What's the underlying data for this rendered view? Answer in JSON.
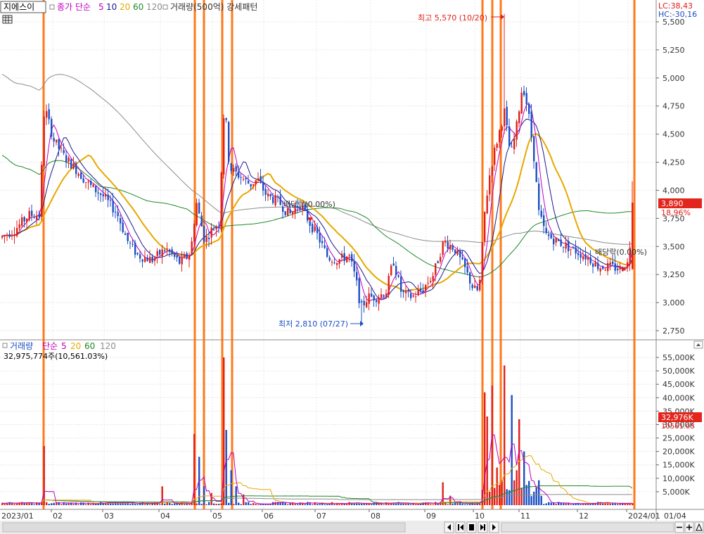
{
  "colors": {
    "up": "#e0201b",
    "down": "#1c4fc4",
    "ma5": "#c000c0",
    "ma10": "#1a1a8c",
    "ma20": "#e8a800",
    "ma60": "#1e8a28",
    "ma120": "#8c8c8c",
    "pattern": "#ff6a00",
    "axis_text": "#333333",
    "badge_red": "#e3261d"
  },
  "top_legend": {
    "stock_name": "지에스이",
    "close_label": "종가 단순",
    "ma_periods": [
      "5",
      "10",
      "20",
      "60",
      "120"
    ],
    "volume_label": "거래량(500억) 강세패턴"
  },
  "top_right": {
    "lc": "LC:38,43",
    "hc": "HC:-30,16"
  },
  "price_axis": {
    "ticks": [
      "5,500",
      "5,250",
      "5,000",
      "4,750",
      "4,500",
      "4,250",
      "4,000",
      "3,750",
      "3,500",
      "3,250",
      "3,000",
      "2,750"
    ],
    "current_price": "3,890",
    "current_change": "18.96%"
  },
  "annotations": {
    "high": "최고 5,570 (10/20)",
    "low": "최저 2,810 (07/27)",
    "dividend1": "배당락(0.00%)",
    "dividend2": "배당락(0.00%)"
  },
  "volume_legend": {
    "label": "거래량",
    "ma_label": "단순",
    "ma_periods": [
      "5",
      "20",
      "60",
      "120"
    ],
    "value": "32,975,774주(10,561.03%)"
  },
  "volume_axis": {
    "ticks": [
      "55,000K",
      "50,000K",
      "45,000K",
      "40,000K",
      "35,000K",
      "30,000K",
      "25,000K",
      "20,000K",
      "15,000K",
      "10,000K",
      "5,000K"
    ],
    "current_volume": "32,976K",
    "current_pct": "10561.03"
  },
  "x_axis": {
    "labels": [
      "2023/01",
      "02",
      "03",
      "04",
      "05",
      "06",
      "07",
      "08",
      "09",
      "10",
      "11",
      "12",
      "2024/01",
      "01/04"
    ]
  },
  "chart_data": [
    {
      "type": "candlestick",
      "title": "",
      "series": [
        {
          "name": "종가 단순 5"
        },
        {
          "name": "10"
        },
        {
          "name": "20"
        },
        {
          "name": "60"
        },
        {
          "name": "120"
        }
      ],
      "ylim": [
        2650,
        5600
      ],
      "x": [
        "2023/01",
        "02",
        "03",
        "04",
        "05",
        "06",
        "07",
        "08",
        "09",
        "10",
        "11",
        "12",
        "2024/01"
      ],
      "highlights": [
        {
          "label": "최고",
          "value": 5570,
          "date": "10/20"
        },
        {
          "label": "최저",
          "value": 2810,
          "date": "07/27"
        }
      ],
      "last_price": 3890
    },
    {
      "type": "bar",
      "title": "",
      "series": [
        {
          "name": "거래량"
        },
        {
          "name": "단순 5"
        },
        {
          "name": "20"
        },
        {
          "name": "60"
        },
        {
          "name": "120"
        }
      ],
      "ylim": [
        0,
        60000
      ],
      "last_volume": 32975774
    }
  ]
}
